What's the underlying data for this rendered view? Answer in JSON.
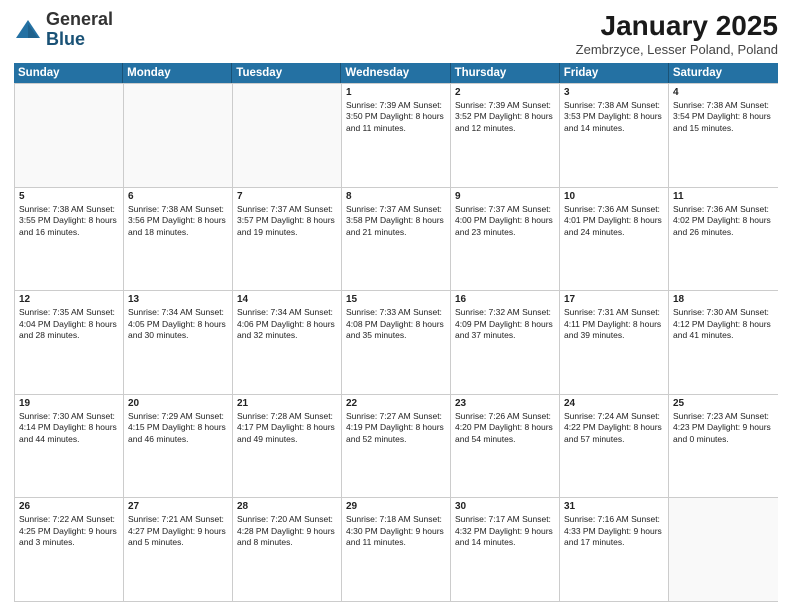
{
  "header": {
    "logo_general": "General",
    "logo_blue": "Blue",
    "month_title": "January 2025",
    "location": "Zembrzyce, Lesser Poland, Poland"
  },
  "weekdays": [
    "Sunday",
    "Monday",
    "Tuesday",
    "Wednesday",
    "Thursday",
    "Friday",
    "Saturday"
  ],
  "rows": [
    [
      {
        "day": "",
        "info": "",
        "empty": true
      },
      {
        "day": "",
        "info": "",
        "empty": true
      },
      {
        "day": "",
        "info": "",
        "empty": true
      },
      {
        "day": "1",
        "info": "Sunrise: 7:39 AM\nSunset: 3:50 PM\nDaylight: 8 hours\nand 11 minutes.",
        "empty": false
      },
      {
        "day": "2",
        "info": "Sunrise: 7:39 AM\nSunset: 3:52 PM\nDaylight: 8 hours\nand 12 minutes.",
        "empty": false
      },
      {
        "day": "3",
        "info": "Sunrise: 7:38 AM\nSunset: 3:53 PM\nDaylight: 8 hours\nand 14 minutes.",
        "empty": false
      },
      {
        "day": "4",
        "info": "Sunrise: 7:38 AM\nSunset: 3:54 PM\nDaylight: 8 hours\nand 15 minutes.",
        "empty": false
      }
    ],
    [
      {
        "day": "5",
        "info": "Sunrise: 7:38 AM\nSunset: 3:55 PM\nDaylight: 8 hours\nand 16 minutes.",
        "empty": false
      },
      {
        "day": "6",
        "info": "Sunrise: 7:38 AM\nSunset: 3:56 PM\nDaylight: 8 hours\nand 18 minutes.",
        "empty": false
      },
      {
        "day": "7",
        "info": "Sunrise: 7:37 AM\nSunset: 3:57 PM\nDaylight: 8 hours\nand 19 minutes.",
        "empty": false
      },
      {
        "day": "8",
        "info": "Sunrise: 7:37 AM\nSunset: 3:58 PM\nDaylight: 8 hours\nand 21 minutes.",
        "empty": false
      },
      {
        "day": "9",
        "info": "Sunrise: 7:37 AM\nSunset: 4:00 PM\nDaylight: 8 hours\nand 23 minutes.",
        "empty": false
      },
      {
        "day": "10",
        "info": "Sunrise: 7:36 AM\nSunset: 4:01 PM\nDaylight: 8 hours\nand 24 minutes.",
        "empty": false
      },
      {
        "day": "11",
        "info": "Sunrise: 7:36 AM\nSunset: 4:02 PM\nDaylight: 8 hours\nand 26 minutes.",
        "empty": false
      }
    ],
    [
      {
        "day": "12",
        "info": "Sunrise: 7:35 AM\nSunset: 4:04 PM\nDaylight: 8 hours\nand 28 minutes.",
        "empty": false
      },
      {
        "day": "13",
        "info": "Sunrise: 7:34 AM\nSunset: 4:05 PM\nDaylight: 8 hours\nand 30 minutes.",
        "empty": false
      },
      {
        "day": "14",
        "info": "Sunrise: 7:34 AM\nSunset: 4:06 PM\nDaylight: 8 hours\nand 32 minutes.",
        "empty": false
      },
      {
        "day": "15",
        "info": "Sunrise: 7:33 AM\nSunset: 4:08 PM\nDaylight: 8 hours\nand 35 minutes.",
        "empty": false
      },
      {
        "day": "16",
        "info": "Sunrise: 7:32 AM\nSunset: 4:09 PM\nDaylight: 8 hours\nand 37 minutes.",
        "empty": false
      },
      {
        "day": "17",
        "info": "Sunrise: 7:31 AM\nSunset: 4:11 PM\nDaylight: 8 hours\nand 39 minutes.",
        "empty": false
      },
      {
        "day": "18",
        "info": "Sunrise: 7:30 AM\nSunset: 4:12 PM\nDaylight: 8 hours\nand 41 minutes.",
        "empty": false
      }
    ],
    [
      {
        "day": "19",
        "info": "Sunrise: 7:30 AM\nSunset: 4:14 PM\nDaylight: 8 hours\nand 44 minutes.",
        "empty": false
      },
      {
        "day": "20",
        "info": "Sunrise: 7:29 AM\nSunset: 4:15 PM\nDaylight: 8 hours\nand 46 minutes.",
        "empty": false
      },
      {
        "day": "21",
        "info": "Sunrise: 7:28 AM\nSunset: 4:17 PM\nDaylight: 8 hours\nand 49 minutes.",
        "empty": false
      },
      {
        "day": "22",
        "info": "Sunrise: 7:27 AM\nSunset: 4:19 PM\nDaylight: 8 hours\nand 52 minutes.",
        "empty": false
      },
      {
        "day": "23",
        "info": "Sunrise: 7:26 AM\nSunset: 4:20 PM\nDaylight: 8 hours\nand 54 minutes.",
        "empty": false
      },
      {
        "day": "24",
        "info": "Sunrise: 7:24 AM\nSunset: 4:22 PM\nDaylight: 8 hours\nand 57 minutes.",
        "empty": false
      },
      {
        "day": "25",
        "info": "Sunrise: 7:23 AM\nSunset: 4:23 PM\nDaylight: 9 hours\nand 0 minutes.",
        "empty": false
      }
    ],
    [
      {
        "day": "26",
        "info": "Sunrise: 7:22 AM\nSunset: 4:25 PM\nDaylight: 9 hours\nand 3 minutes.",
        "empty": false
      },
      {
        "day": "27",
        "info": "Sunrise: 7:21 AM\nSunset: 4:27 PM\nDaylight: 9 hours\nand 5 minutes.",
        "empty": false
      },
      {
        "day": "28",
        "info": "Sunrise: 7:20 AM\nSunset: 4:28 PM\nDaylight: 9 hours\nand 8 minutes.",
        "empty": false
      },
      {
        "day": "29",
        "info": "Sunrise: 7:18 AM\nSunset: 4:30 PM\nDaylight: 9 hours\nand 11 minutes.",
        "empty": false
      },
      {
        "day": "30",
        "info": "Sunrise: 7:17 AM\nSunset: 4:32 PM\nDaylight: 9 hours\nand 14 minutes.",
        "empty": false
      },
      {
        "day": "31",
        "info": "Sunrise: 7:16 AM\nSunset: 4:33 PM\nDaylight: 9 hours\nand 17 minutes.",
        "empty": false
      },
      {
        "day": "",
        "info": "",
        "empty": true
      }
    ]
  ]
}
